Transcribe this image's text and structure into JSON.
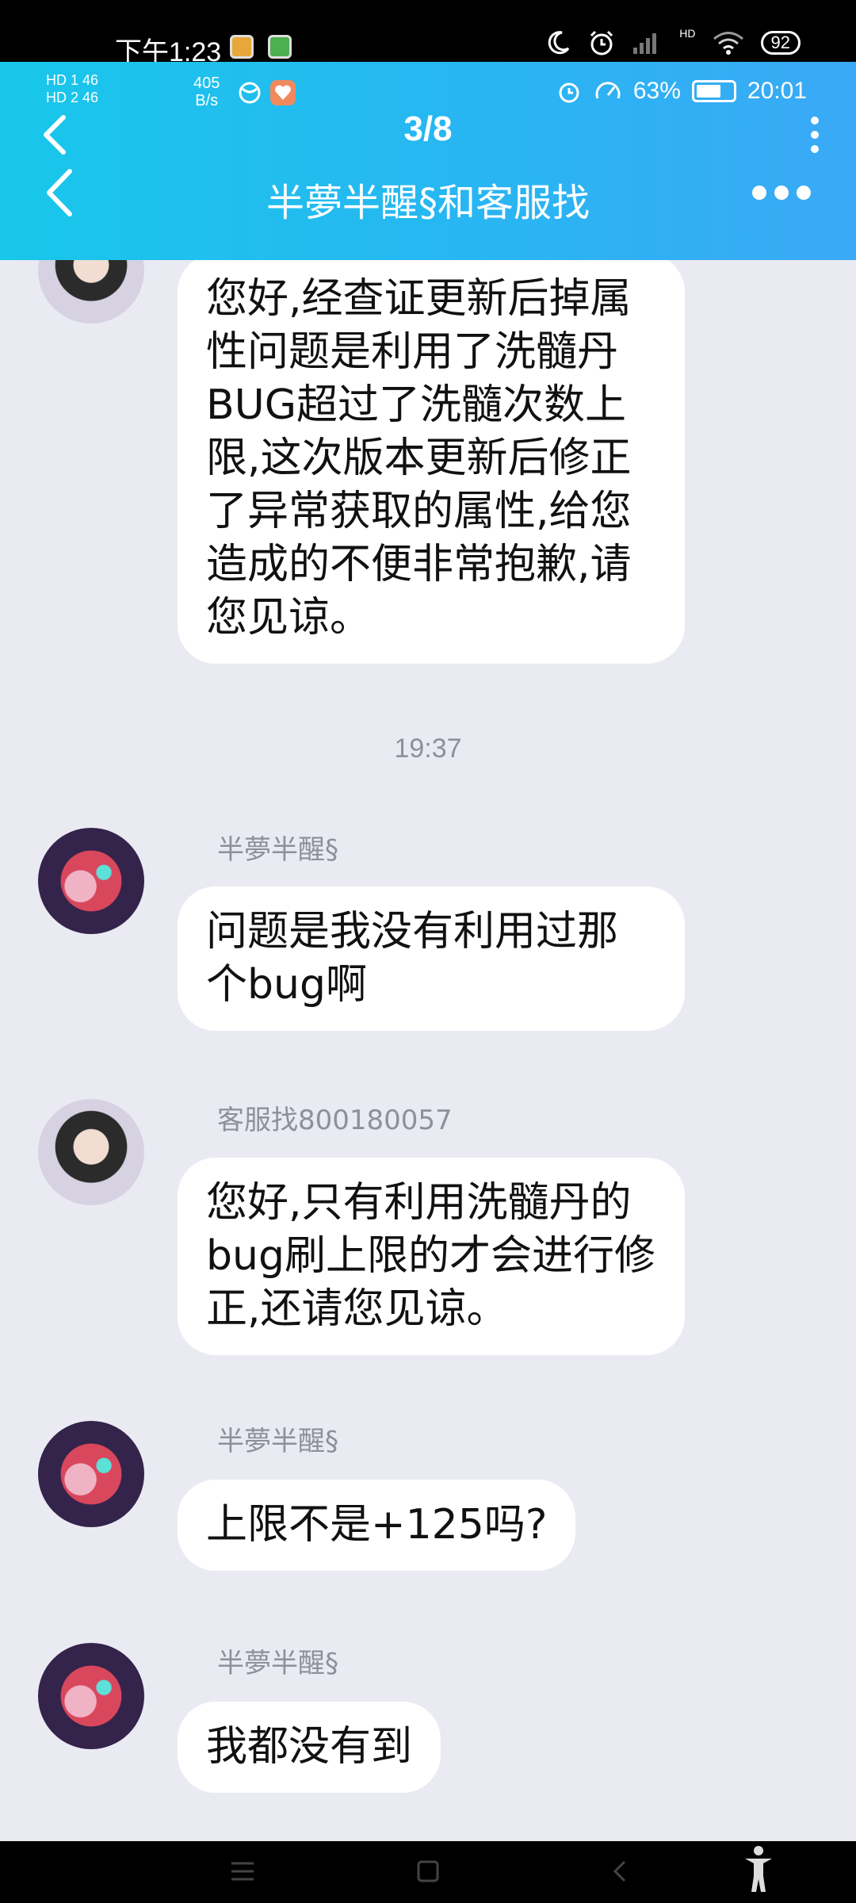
{
  "outer_status": {
    "time": "下午1:23",
    "battery": "92",
    "hd_label": "HD"
  },
  "inner_status": {
    "sim1": "HD 1  46",
    "sim2": "HD 2  46",
    "speed_value": "405",
    "speed_unit": "B/s",
    "battery_percent": "63%",
    "time": "20:01"
  },
  "header": {
    "counter": "3/8",
    "title": "半夢半醒§和客服找"
  },
  "messages": [
    {
      "sender": "",
      "avatar": "agent",
      "text": "您好,经查证更新后掉属性问题是利用了洗髓丹BUG超过了洗髓次数上限,这次版本更新后修正了异常获取的属性,给您造成的不便非常抱歉,请您见谅。"
    },
    {
      "sender": "半夢半醒§",
      "avatar": "anime",
      "text": "问题是我没有利用过那个bug啊"
    },
    {
      "sender": "客服找800180057",
      "avatar": "agent",
      "text": "您好,只有利用洗髓丹的bug刷上限的才会进行修正,还请您见谅。"
    },
    {
      "sender": "半夢半醒§",
      "avatar": "anime",
      "text": "上限不是+125吗?"
    },
    {
      "sender": "半夢半醒§",
      "avatar": "anime",
      "text": "我都没有到"
    }
  ],
  "timestamp": "19:37",
  "icons": {
    "back": "chevron-left-icon",
    "more_vertical": "more-vertical-icon",
    "more_horizontal": "more-horizontal-icon",
    "nav_menu": "menu-icon",
    "nav_home": "home-icon",
    "nav_back": "back-icon",
    "nav_accessibility": "accessibility-icon"
  },
  "colors": {
    "header_start": "#18c7ea",
    "header_end": "#3aa9f6",
    "chat_background": "#eaeaf3",
    "bubble": "#ffffff"
  }
}
